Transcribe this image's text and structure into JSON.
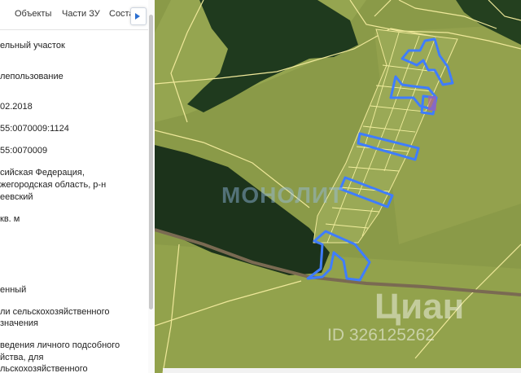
{
  "tabs": [
    "Объекты",
    "Части ЗУ",
    "Соста"
  ],
  "fields": [
    "ельный участок",
    "лепользование",
    "02.2018",
    "55:0070009:1124",
    "55:0070009",
    "сийская Федерация,",
    "жегородская область, р-н",
    "еевский",
    "кв. м",
    "енный",
    "ли сельскохозяйственного",
    "значения",
    "ведения личного подсобного",
    "йства, для",
    "льскохозяйственного"
  ],
  "map": {
    "watermark_left": "МОНОЛИТ",
    "watermark_right": "Циан",
    "listing_id": "ID 326125262"
  },
  "colors": {
    "field": "#8a9a48",
    "forest": "#1f3a1e",
    "plot_outline": "#3f7dff",
    "boundary": "#efe89a",
    "road": "#7a6a52"
  }
}
